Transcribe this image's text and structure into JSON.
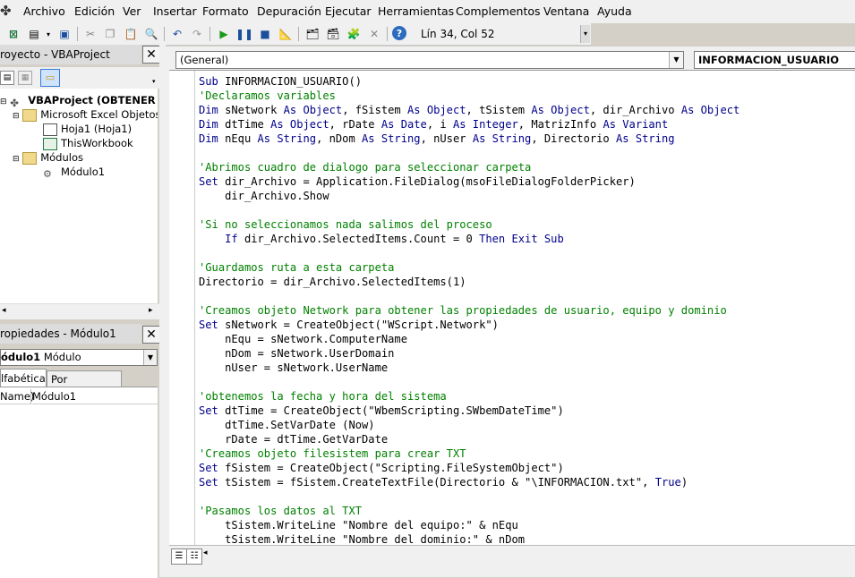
{
  "menubar": {
    "items": [
      "Archivo",
      "Edición",
      "Ver",
      "Insertar",
      "Formato",
      "Depuración",
      "Ejecutar",
      "Herramientas",
      "Complementos",
      "Ventana",
      "Ayuda"
    ]
  },
  "toolbar": {
    "cursor_position": "Lín 34, Col 52",
    "buttons": [
      "excel-icon",
      "insert-userform-icon",
      "save-icon",
      "cut-icon",
      "copy-icon",
      "paste-icon",
      "find-icon",
      "undo-icon",
      "redo-icon",
      "run-icon",
      "break-icon",
      "reset-icon",
      "design-mode-icon",
      "project-explorer-icon",
      "properties-window-icon",
      "object-browser-icon",
      "toolbox-icon",
      "help-icon"
    ]
  },
  "project_panel": {
    "title": "royecto - VBAProject",
    "tree": [
      {
        "label": "VBAProject (OBTENER DAT",
        "level": 0,
        "bold": true,
        "icon": "vbaproject-icon"
      },
      {
        "label": "Microsoft Excel Objetos",
        "level": 1,
        "icon": "folder-icon"
      },
      {
        "label": "Hoja1 (Hoja1)",
        "level": 2,
        "icon": "worksheet-icon"
      },
      {
        "label": "ThisWorkbook",
        "level": 2,
        "icon": "workbook-icon"
      },
      {
        "label": "Módulos",
        "level": 1,
        "icon": "folder-icon"
      },
      {
        "label": "Módulo1",
        "level": 2,
        "icon": "module-icon"
      }
    ]
  },
  "properties_panel": {
    "title": "ropiedades - Módulo1",
    "object_bold": "ódulo1",
    "object_type": "Módulo",
    "tabs": [
      "lfabética",
      "Por categorías"
    ],
    "rows": [
      {
        "name": "Name)",
        "value": "Módulo1"
      }
    ]
  },
  "code_window": {
    "object_combo": "(General)",
    "procedure_combo": "INFORMACION_USUARIO",
    "lines": [
      [
        [
          "kw",
          "Sub "
        ],
        [
          "tx",
          "INFORMACION_USUARIO()"
        ]
      ],
      [
        [
          "cm",
          "'Declaramos variables"
        ]
      ],
      [
        [
          "kw",
          "Dim "
        ],
        [
          "tx",
          "sNetwork "
        ],
        [
          "kw",
          "As Object"
        ],
        [
          "tx",
          ", fSistem "
        ],
        [
          "kw",
          "As Object"
        ],
        [
          "tx",
          ", tSistem "
        ],
        [
          "kw",
          "As Object"
        ],
        [
          "tx",
          ", dir_Archivo "
        ],
        [
          "kw",
          "As Object"
        ]
      ],
      [
        [
          "kw",
          "Dim "
        ],
        [
          "tx",
          "dtTime "
        ],
        [
          "kw",
          "As Object"
        ],
        [
          "tx",
          ", rDate "
        ],
        [
          "kw",
          "As Date"
        ],
        [
          "tx",
          ", i "
        ],
        [
          "kw",
          "As Integer"
        ],
        [
          "tx",
          ", MatrizInfo "
        ],
        [
          "kw",
          "As Variant"
        ]
      ],
      [
        [
          "kw",
          "Dim "
        ],
        [
          "tx",
          "nEqu "
        ],
        [
          "kw",
          "As String"
        ],
        [
          "tx",
          ", nDom "
        ],
        [
          "kw",
          "As String"
        ],
        [
          "tx",
          ", nUser "
        ],
        [
          "kw",
          "As String"
        ],
        [
          "tx",
          ", Directorio "
        ],
        [
          "kw",
          "As String"
        ]
      ],
      [],
      [
        [
          "cm",
          "'Abrimos cuadro de dialogo para seleccionar carpeta"
        ]
      ],
      [
        [
          "kw",
          "Set "
        ],
        [
          "tx",
          "dir_Archivo = Application.FileDialog(msoFileDialogFolderPicker)"
        ]
      ],
      [
        [
          "tx",
          "    dir_Archivo.Show"
        ]
      ],
      [],
      [
        [
          "cm",
          "'Si no seleccionamos nada salimos del proceso"
        ]
      ],
      [
        [
          "tx",
          "    "
        ],
        [
          "kw",
          "If "
        ],
        [
          "tx",
          "dir_Archivo.SelectedItems.Count = 0 "
        ],
        [
          "kw",
          "Then Exit Sub"
        ]
      ],
      [],
      [
        [
          "cm",
          "'Guardamos ruta a esta carpeta"
        ]
      ],
      [
        [
          "tx",
          "Directorio = dir_Archivo.SelectedItems(1)"
        ]
      ],
      [],
      [
        [
          "cm",
          "'Creamos objeto Network para obtener las propiedades de usuario, equipo y dominio"
        ]
      ],
      [
        [
          "kw",
          "Set "
        ],
        [
          "tx",
          "sNetwork = CreateObject(\"WScript.Network\")"
        ]
      ],
      [
        [
          "tx",
          "    nEqu = sNetwork.ComputerName"
        ]
      ],
      [
        [
          "tx",
          "    nDom = sNetwork.UserDomain"
        ]
      ],
      [
        [
          "tx",
          "    nUser = sNetwork.UserName"
        ]
      ],
      [],
      [
        [
          "cm",
          "'obtenemos la fecha y hora del sistema"
        ]
      ],
      [
        [
          "kw",
          "Set "
        ],
        [
          "tx",
          "dtTime = CreateObject(\"WbemScripting.SWbemDateTime\")"
        ]
      ],
      [
        [
          "tx",
          "    dtTime.SetVarDate (Now)"
        ]
      ],
      [
        [
          "tx",
          "    rDate = dtTime.GetVarDate"
        ]
      ],
      [
        [
          "cm",
          "'Creamos objeto filesistem para crear TXT"
        ]
      ],
      [
        [
          "kw",
          "Set "
        ],
        [
          "tx",
          "fSistem = CreateObject(\"Scripting.FileSystemObject\")"
        ]
      ],
      [
        [
          "kw",
          "Set "
        ],
        [
          "tx",
          "tSistem = fSistem.CreateTextFile(Directorio & \"\\INFORMACION.txt\", "
        ],
        [
          "kw",
          "True"
        ],
        [
          "tx",
          ")"
        ]
      ],
      [],
      [
        [
          "cm",
          "'Pasamos los datos al TXT"
        ]
      ],
      [
        [
          "tx",
          "    tSistem.WriteLine \"Nombre del equipo:\" & nEqu"
        ]
      ],
      [
        [
          "tx",
          "    tSistem.WriteLine \"Nombre del dominio:\" & nDom"
        ]
      ]
    ]
  }
}
